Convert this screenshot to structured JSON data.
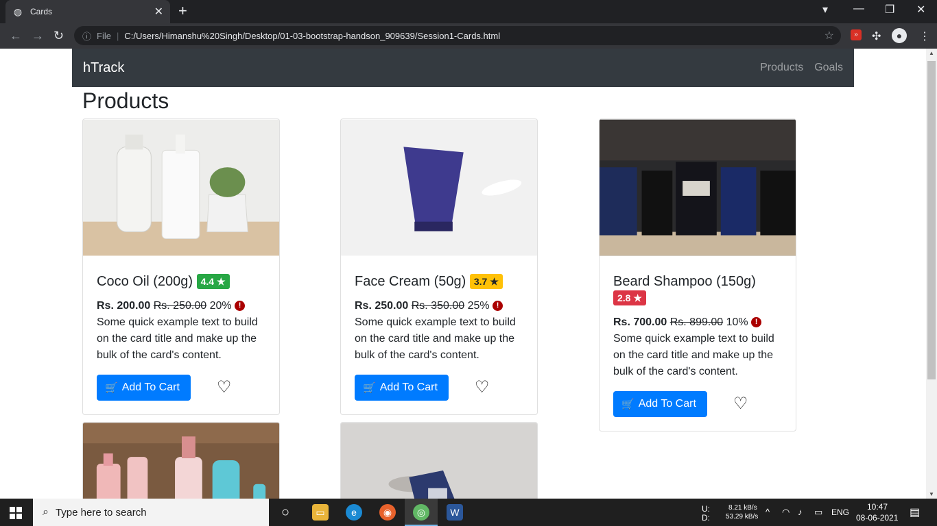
{
  "browser": {
    "tab_title": "Cards",
    "url_prefix": "File",
    "url": "C:/Users/Himanshu%20Singh/Desktop/01-03-bootstrap-handson_909639/Session1-Cards.html"
  },
  "navbar": {
    "brand": "hTrack",
    "links": [
      "Products",
      "Goals"
    ]
  },
  "page_title": "Products",
  "cards": [
    {
      "title": "Coco Oil (200g)",
      "rating": "4.4",
      "price": "Rs. 200.00",
      "old_price": "Rs. 250.00",
      "discount": "20%",
      "description": "Some quick example text to build on the card title and make up the bulk of the card's content.",
      "button": "Add To Cart",
      "rating_color": "#28a745"
    },
    {
      "title": "Face Cream (50g)",
      "rating": "3.7",
      "price": "Rs. 250.00",
      "old_price": "Rs. 350.00",
      "discount": "25%",
      "description": "Some quick example text to build on the card title and make up the bulk of the card's content.",
      "button": "Add To Cart",
      "rating_color": "#ffc107"
    },
    {
      "title": "Beard Shampoo (150g)",
      "rating": "2.8",
      "price": "Rs. 700.00",
      "old_price": "Rs. 899.00",
      "discount": "10%",
      "description": "Some quick example text to build on the card title and make up the bulk of the card's content.",
      "button": "Add To Cart",
      "rating_color": "#dc3545"
    }
  ],
  "taskbar": {
    "search_placeholder": "Type here to search",
    "upload_label": "U:",
    "download_label": "D:",
    "upload_speed": "8.21 kB/s",
    "download_speed": "53.29 kB/s",
    "language": "ENG",
    "time": "10:47",
    "date": "08-06-2021"
  },
  "colors": {
    "primary": "#007bff",
    "navbar": "#343a40"
  }
}
